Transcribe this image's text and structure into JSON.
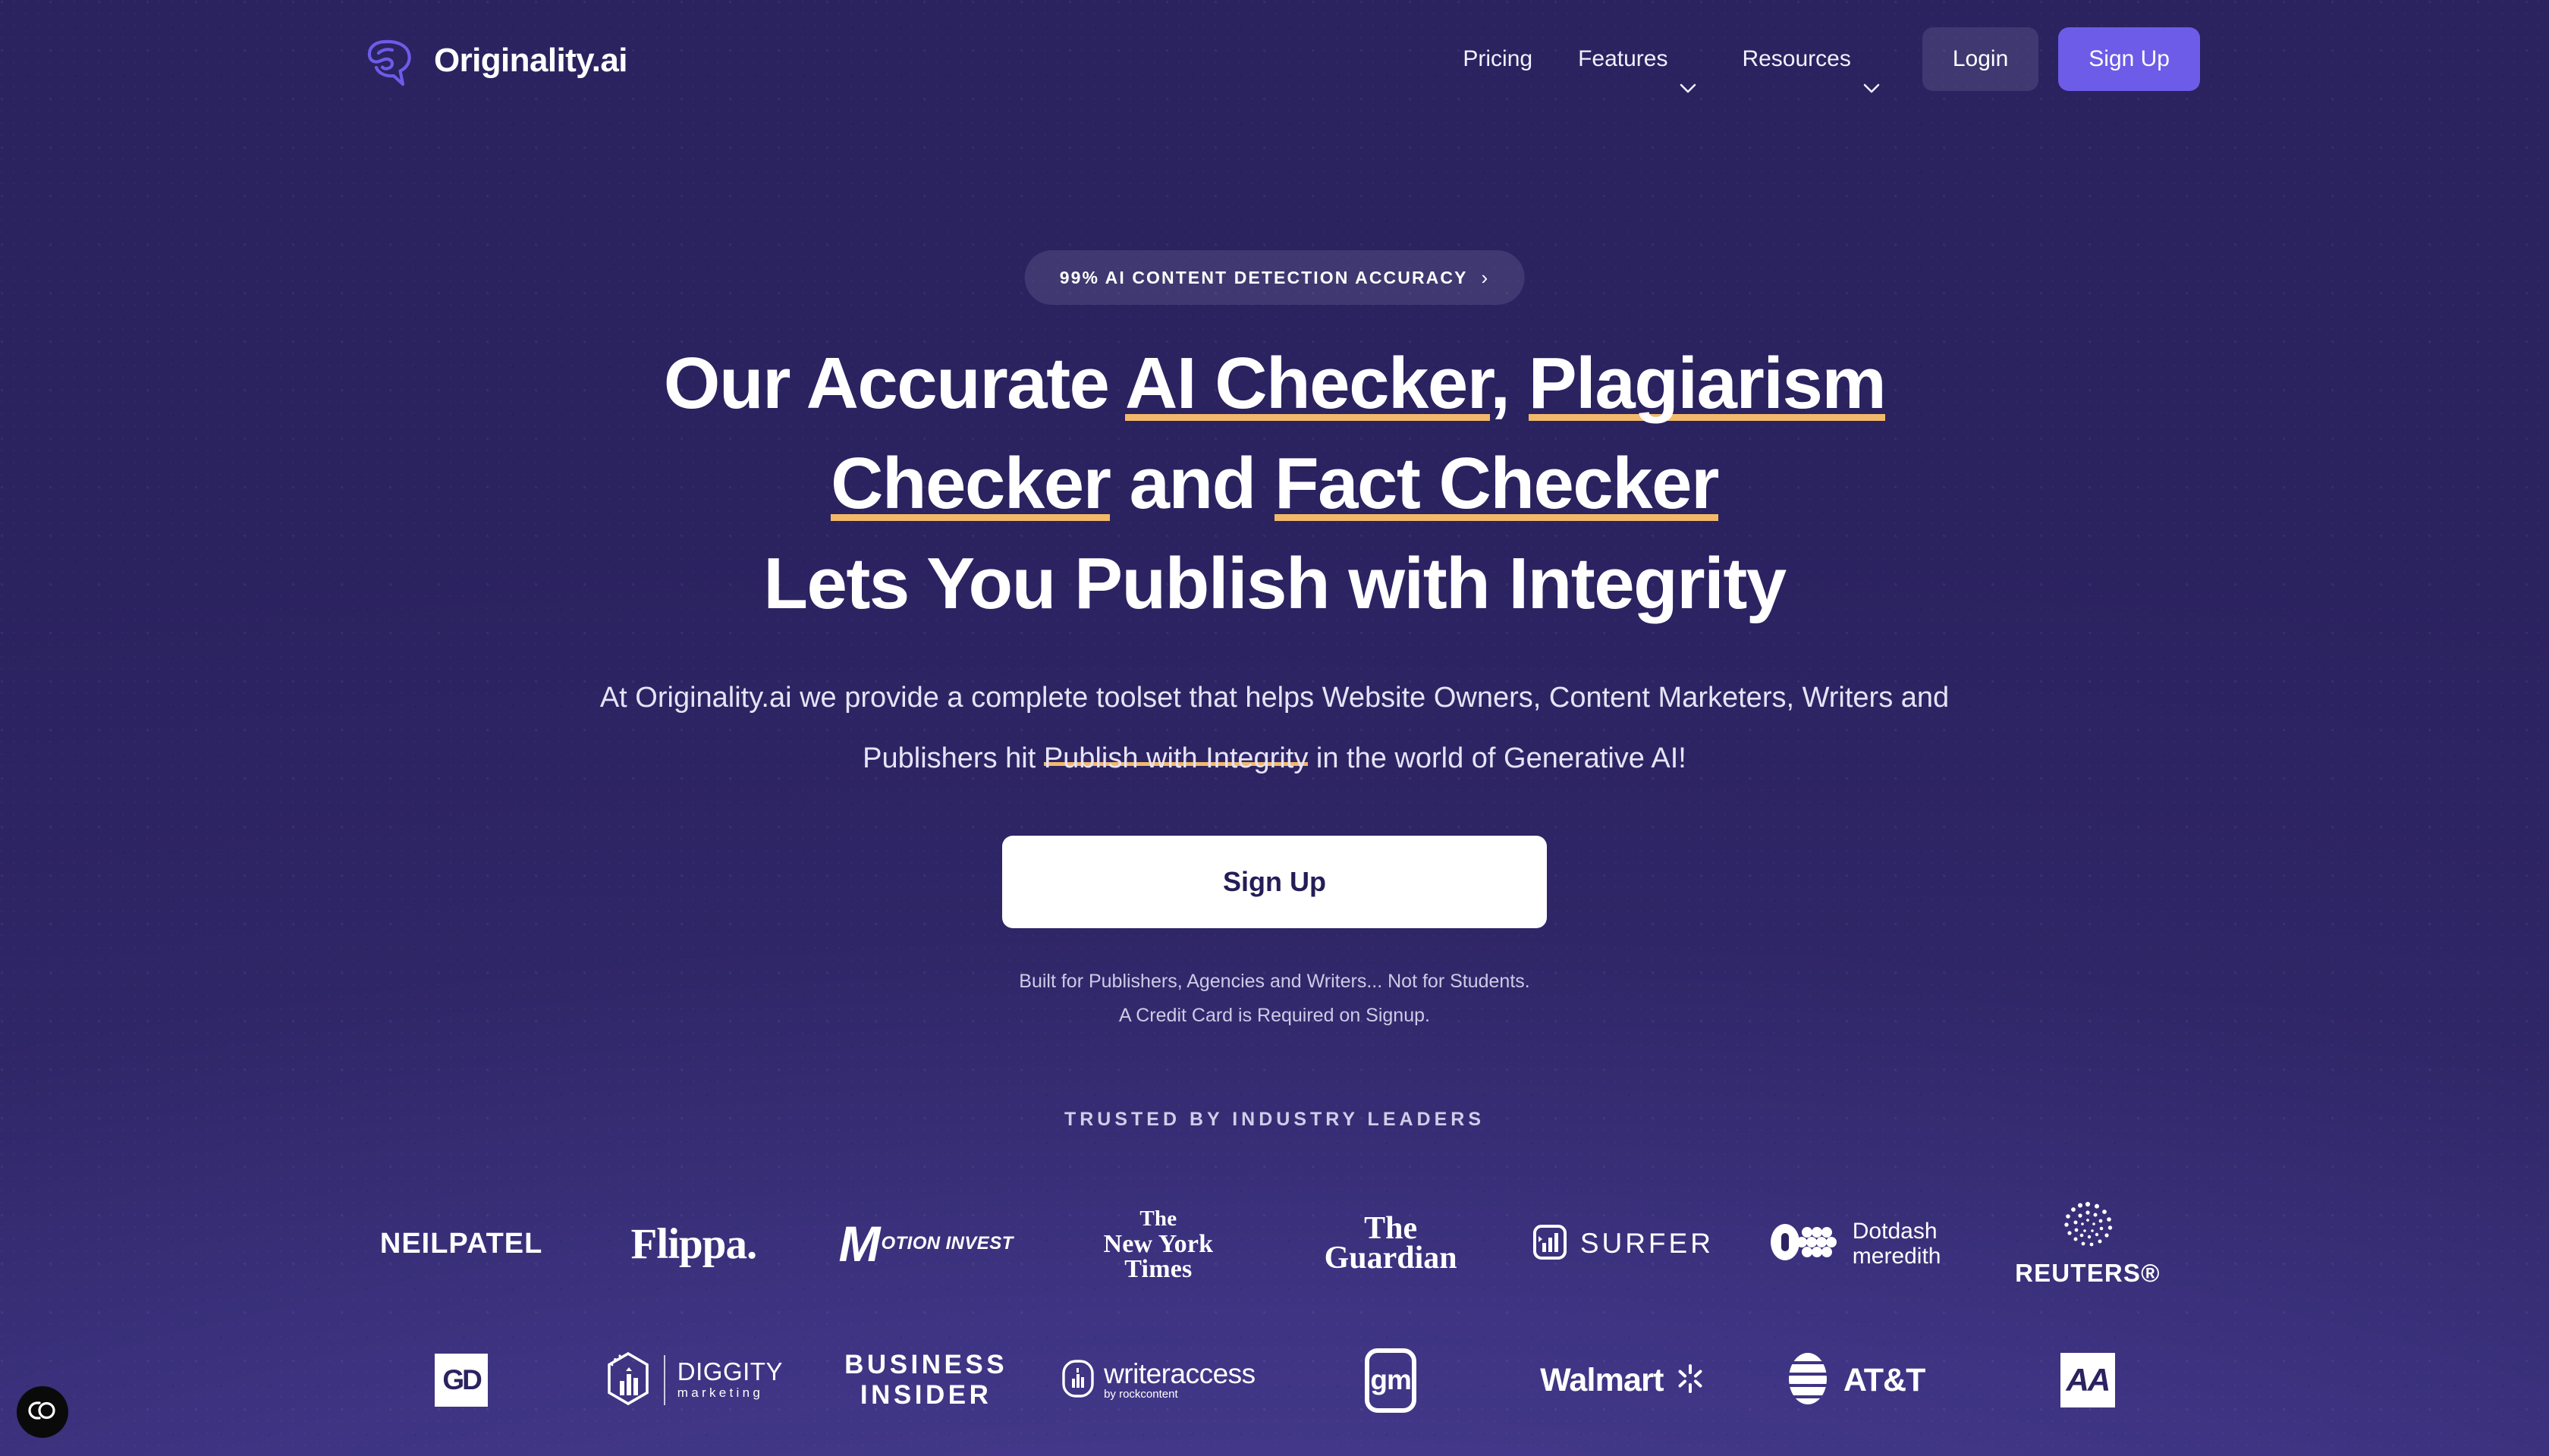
{
  "brand": {
    "name": "Originality.ai",
    "logo_icon": "brain-speech-bubble-icon",
    "accent_purple": "#6c5ce7",
    "bg_purple": "#2b2260",
    "bg_purple_light": "#4d4196",
    "underline_orange": "#f3b96b"
  },
  "nav": {
    "items": [
      {
        "label": "Pricing",
        "has_chevron": false,
        "icon": ""
      },
      {
        "label": "Features",
        "has_chevron": true,
        "icon": "chevron-down-icon"
      },
      {
        "label": "Resources",
        "has_chevron": true,
        "icon": "chevron-down-icon"
      }
    ],
    "login_label": "Login",
    "signup_label": "Sign Up"
  },
  "hero": {
    "badge_text": "99% AI CONTENT DETECTION ACCURACY",
    "badge_arrow": "›",
    "headline": {
      "line1_a": "Our Accurate ",
      "line1_u1": "AI Checker",
      "line1_b": ", ",
      "line1_u2": "Plagiarism",
      "line2_u1": "Checker",
      "line2_b": " and ",
      "line2_u2": "Fact Checker",
      "line3": "Lets You Publish with Integrity"
    },
    "subtitle_a": "At Originality.ai we provide a complete toolset that helps Website Owners, Content Marketers, Writers and Publishers hit ",
    "subtitle_u": "Publish with Integrity",
    "subtitle_b": " in the world of Generative AI!",
    "cta_label": "Sign Up",
    "fineprint_line1": "Built for Publishers, Agencies and Writers... Not for Students.",
    "fineprint_line2": "A Credit Card is Required on Signup."
  },
  "trusted": {
    "label": "TRUSTED BY INDUSTRY LEADERS",
    "row1": [
      {
        "name": "neilpatel",
        "text": "NEILPATEL"
      },
      {
        "name": "flippa",
        "text": "Flippa."
      },
      {
        "name": "motion-invest",
        "text_m": "M",
        "text": "OTION INVEST"
      },
      {
        "name": "new-york-times",
        "l1": "The",
        "l2": "New York",
        "l3": "Times"
      },
      {
        "name": "the-guardian",
        "l1": "The",
        "l2": "Guardian"
      },
      {
        "name": "surfer",
        "text": "SURFER"
      },
      {
        "name": "dotdash-meredith",
        "l1": "Dotdash",
        "l2": "meredith"
      },
      {
        "name": "reuters",
        "text": "REUTERS®"
      }
    ],
    "row2": [
      {
        "name": "gd",
        "text": "GD"
      },
      {
        "name": "diggity-marketing",
        "l1": "DIGGITY",
        "l2": "marketing"
      },
      {
        "name": "business-insider",
        "l1": "BUSINESS",
        "l2": "INSIDER"
      },
      {
        "name": "writeraccess",
        "l1": "writeraccess",
        "l2": "by rockcontent"
      },
      {
        "name": "gm",
        "text": "gm"
      },
      {
        "name": "walmart",
        "text": "Walmart"
      },
      {
        "name": "att",
        "text": "AT&T"
      },
      {
        "name": "american-airlines",
        "text": "AA"
      }
    ]
  },
  "accessibility_widget": {
    "icon": "accessibility-toggle-icon"
  }
}
